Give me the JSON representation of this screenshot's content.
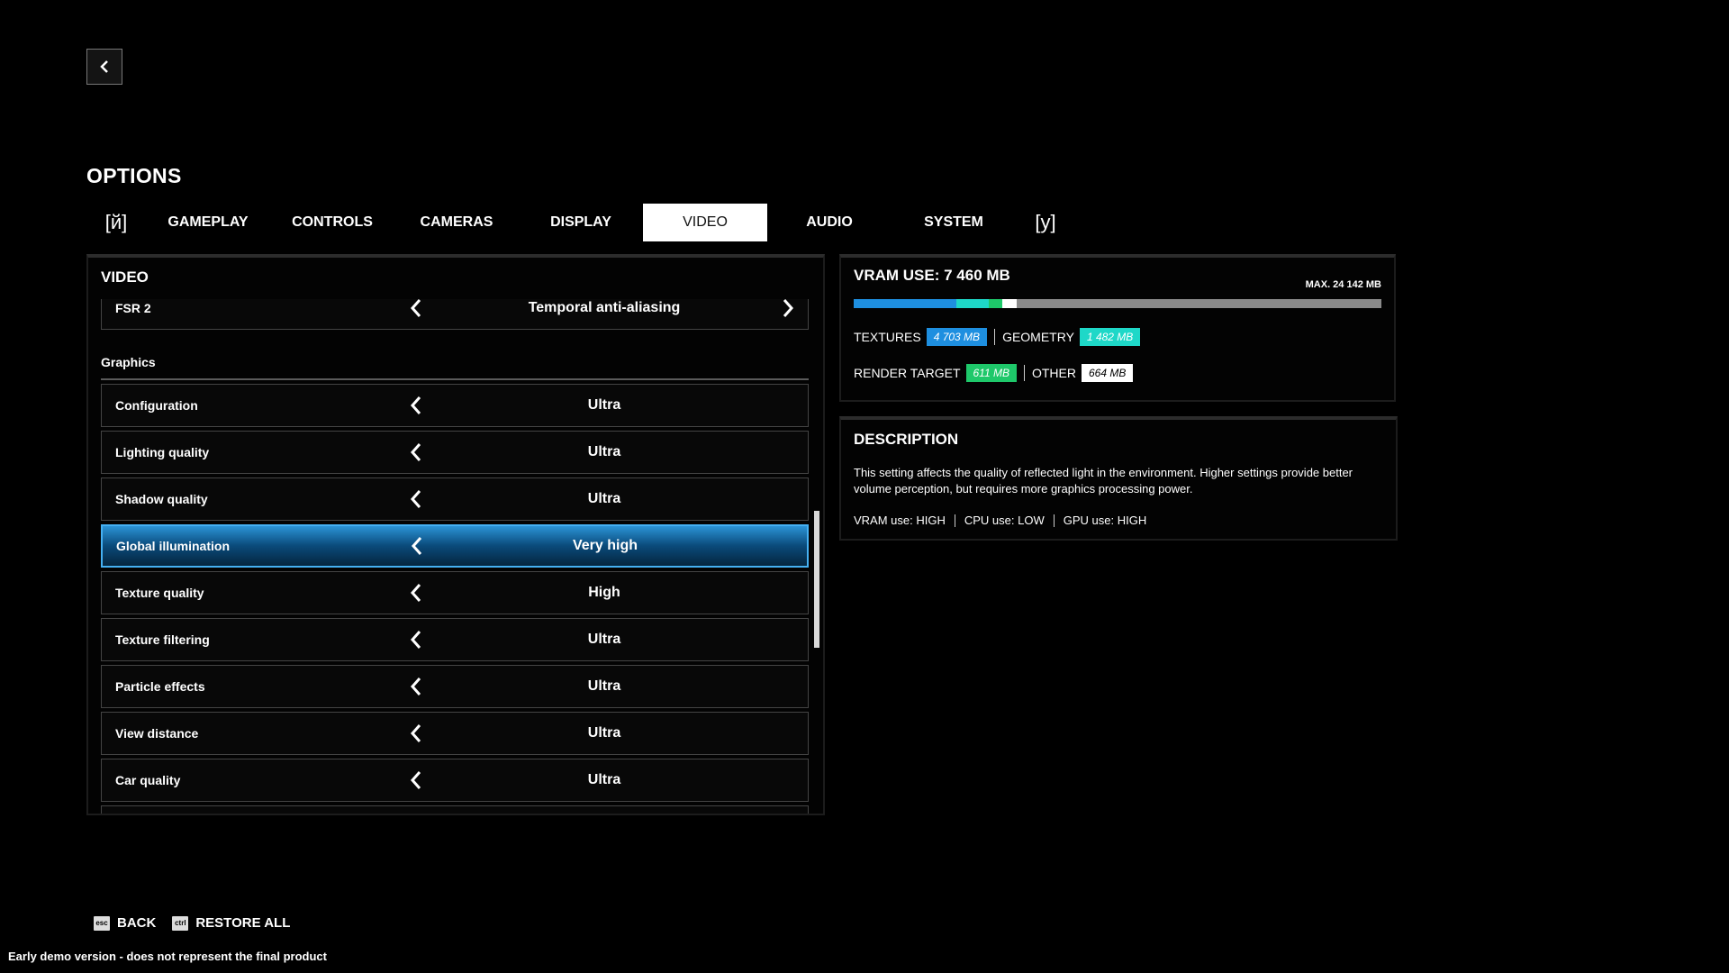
{
  "header": {
    "back_icon": "chevron-left-icon",
    "title": "OPTIONS"
  },
  "tabs": {
    "prev_key": "[й]",
    "next_key": "[у]",
    "items": [
      {
        "label": "GAMEPLAY",
        "active": false
      },
      {
        "label": "CONTROLS",
        "active": false
      },
      {
        "label": "CAMERAS",
        "active": false
      },
      {
        "label": "DISPLAY",
        "active": false
      },
      {
        "label": "VIDEO",
        "active": true
      },
      {
        "label": "AUDIO",
        "active": false
      },
      {
        "label": "SYSTEM",
        "active": false
      }
    ]
  },
  "video_panel": {
    "title": "VIDEO",
    "top_row": {
      "label": "FSR 2",
      "value": "Temporal anti-aliasing"
    },
    "section_label": "Graphics",
    "rows": [
      {
        "label": "Configuration",
        "value": "Ultra"
      },
      {
        "label": "Lighting quality",
        "value": "Ultra"
      },
      {
        "label": "Shadow quality",
        "value": "Ultra"
      },
      {
        "label": "Global illumination",
        "value": "Very high",
        "selected": true
      },
      {
        "label": "Texture quality",
        "value": "High"
      },
      {
        "label": "Texture filtering",
        "value": "Ultra"
      },
      {
        "label": "Particle effects",
        "value": "Ultra"
      },
      {
        "label": "View distance",
        "value": "Ultra"
      },
      {
        "label": "Car quality",
        "value": "Ultra"
      },
      {
        "label": "",
        "value": ""
      }
    ]
  },
  "vram": {
    "title": "VRAM USE: 7 460 MB",
    "max_label": "MAX. 24 142 MB",
    "total_mb": 24142,
    "segments": [
      {
        "name": "TEXTURES",
        "value_label": "4 703 MB",
        "mb": 4703,
        "color": "#1e8fe0",
        "text_color": "#ffffff"
      },
      {
        "name": "GEOMETRY",
        "value_label": "1 482 MB",
        "mb": 1482,
        "color": "#1ed8c8",
        "text_color": "#ffffff"
      },
      {
        "name": "RENDER TARGET",
        "value_label": "611 MB",
        "mb": 611,
        "color": "#1ec86a",
        "text_color": "#ffffff"
      },
      {
        "name": "OTHER",
        "value_label": "664 MB",
        "mb": 664,
        "color": "#ffffff",
        "text_color": "#000000"
      }
    ],
    "remaining_color": "#8a8a8a"
  },
  "description": {
    "title": "DESCRIPTION",
    "text": "This setting affects the quality of reflected light in the environment. Higher settings provide better volume perception, but requires more graphics processing power.",
    "usage": [
      {
        "label": "VRAM use:",
        "value": "HIGH"
      },
      {
        "label": "CPU use:",
        "value": "LOW"
      },
      {
        "label": "GPU use:",
        "value": "HIGH"
      }
    ]
  },
  "footer": {
    "back_key": "esc",
    "back_label": "BACK",
    "restore_key": "ctrl",
    "restore_label": "RESTORE ALL",
    "demo_note": "Early demo version - does not represent the final product"
  }
}
